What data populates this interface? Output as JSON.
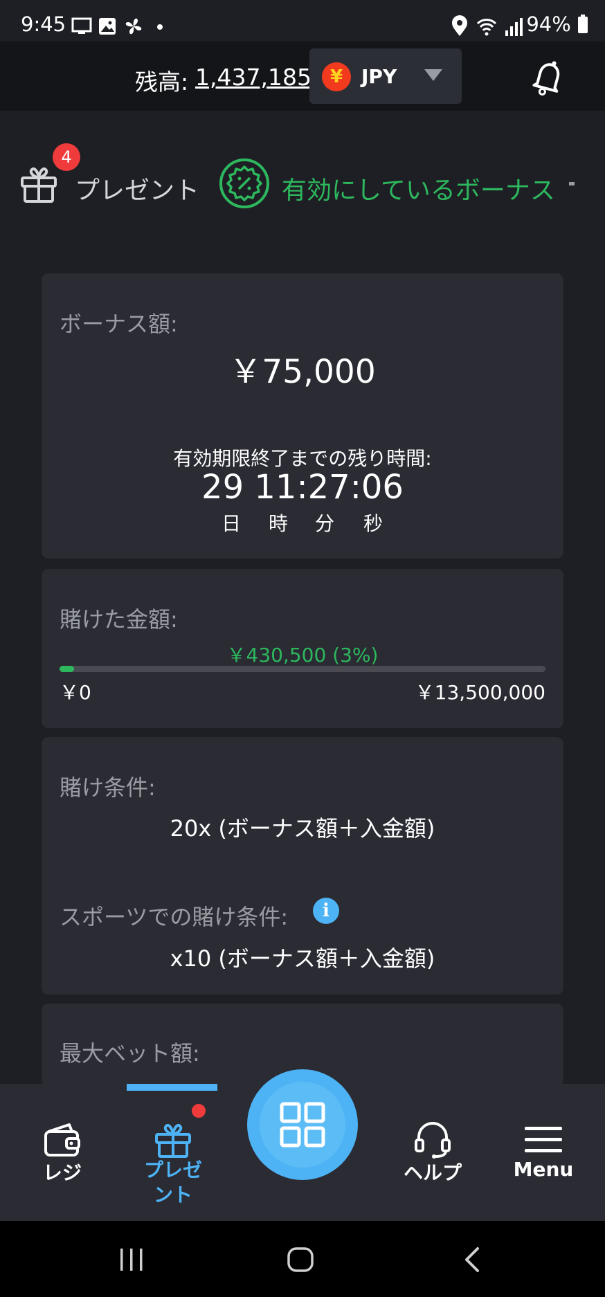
{
  "status_bar": {
    "time": "9:45",
    "battery": "94%"
  },
  "header": {
    "balance_label": "残高:",
    "balance_value": "1,437,185",
    "currency_symbol": "¥",
    "currency_code": "JPY"
  },
  "tabs": {
    "present_label": "プレゼント",
    "present_badge": "4",
    "active_bonus_label": "有効にしているボーナス"
  },
  "bonus_card": {
    "amount_label": "ボーナス額:",
    "amount_value": "￥75,000",
    "expiry_label": "有効期限終了までの残り時間:",
    "countdown": "29 11:27:06",
    "units": [
      "日",
      "時",
      "分",
      "秒"
    ]
  },
  "bet_card": {
    "label": "賭けた金額:",
    "progress_text": "￥430,500 (3%)",
    "progress_percent": 3,
    "min_label": "￥0",
    "max_label": "￥13,500,000"
  },
  "wager_card": {
    "label": "賭け条件:",
    "value": "20x (ボーナス額＋入金額)",
    "sports_label": "スポーツでの賭け条件:",
    "info_glyph": "i",
    "sports_value": "x10 (ボーナス額＋入金額)"
  },
  "max_bet_card": {
    "label": "最大ベット額:"
  },
  "bottom_nav": {
    "items": [
      {
        "label": "レジ",
        "icon": "wallet-icon"
      },
      {
        "label_line1": "プレゼ",
        "label_line2": "ント",
        "icon": "gift-icon"
      },
      {
        "label": "",
        "icon": "grid-icon"
      },
      {
        "label": "ヘルプ",
        "icon": "headset-icon"
      },
      {
        "label": "Menu",
        "icon": "hamburger-icon"
      }
    ]
  },
  "colors": {
    "accent_green": "#2db85e",
    "accent_blue": "#4eb3f5",
    "badge_red": "#ef3b3b",
    "card_bg": "#2a2b33",
    "page_bg": "#1e1f24"
  }
}
